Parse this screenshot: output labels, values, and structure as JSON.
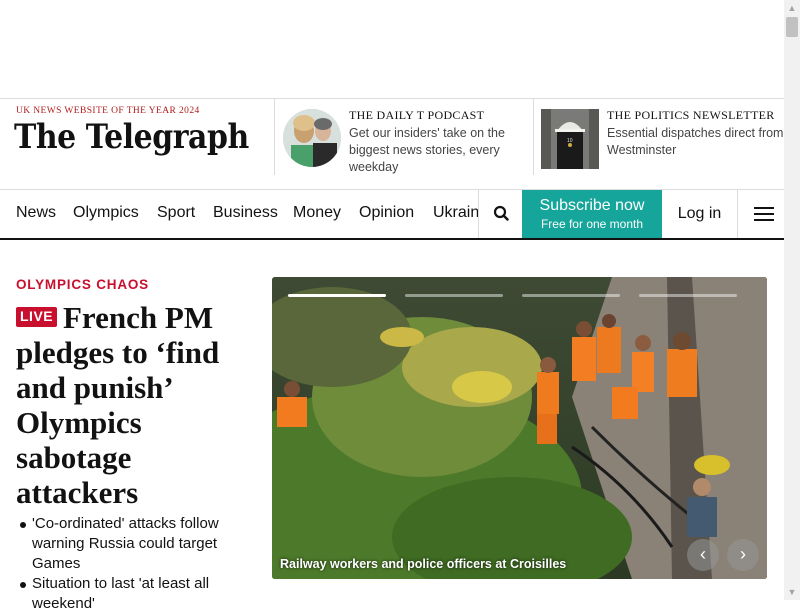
{
  "masthead": {
    "award": "UK NEWS WEBSITE OF THE YEAR 2024",
    "logo_text": "The Telegraph",
    "podcast": {
      "title": "THE DAILY T PODCAST",
      "description": "Get our insiders' take on the biggest news stories, every weekday"
    },
    "newsletter": {
      "title": "THE POLITICS NEWSLETTER",
      "description": "Essential dispatches direct from Westminster"
    }
  },
  "nav": {
    "items": [
      "News",
      "Olympics",
      "Sport",
      "Business",
      "Money",
      "Opinion",
      "Ukraine"
    ],
    "search_icon": "search-icon",
    "subscribe_label": "Subscribe now",
    "subscribe_sub": "Free for one month",
    "login_label": "Log in",
    "menu_icon": "hamburger-menu-icon"
  },
  "lead_story": {
    "kicker": "OLYMPICS CHAOS",
    "live_label": "LIVE",
    "headline": "French PM pledges to ‘find and punish’ Olympics sabotage attackers",
    "bullets": [
      "'Co-ordinated' attacks follow warning Russia could target Games",
      "Situation to last 'at least all weekend'"
    ]
  },
  "hero": {
    "caption": "Railway workers and police officers at Croisilles",
    "slide_count": 4,
    "active_slide": 1,
    "prev_icon": "chevron-left-icon",
    "next_icon": "chevron-right-icon"
  },
  "colors": {
    "accent_red": "#c8102e",
    "subscribe_teal": "#15a59a",
    "text": "#121212"
  }
}
